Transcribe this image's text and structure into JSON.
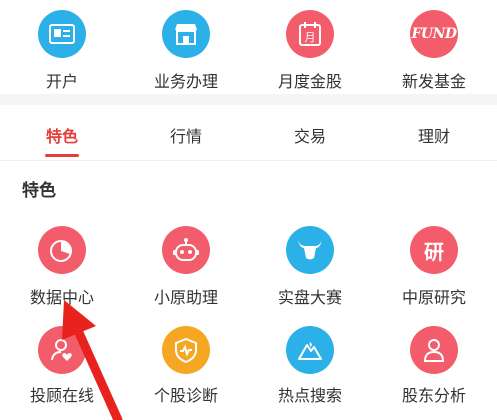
{
  "top_row": [
    {
      "label": "开户",
      "icon": "id-card-icon",
      "color": "#2bb0e8"
    },
    {
      "label": "业务办理",
      "icon": "storefront-icon",
      "color": "#2bb0e8"
    },
    {
      "label": "月度金股",
      "icon": "calendar-icon",
      "color": "#f25c6b"
    },
    {
      "label": "新发基金",
      "icon": "fund-logo-icon",
      "icon_text": "FUND",
      "color": "#f25c6b"
    }
  ],
  "tabs": [
    {
      "label": "特色",
      "active": true
    },
    {
      "label": "行情",
      "active": false
    },
    {
      "label": "交易",
      "active": false
    },
    {
      "label": "理财",
      "active": false
    }
  ],
  "section_title": "特色",
  "feature_row_1": [
    {
      "label": "数据中心",
      "icon": "pie-chart-icon",
      "color": "#f25c6b"
    },
    {
      "label": "小原助理",
      "icon": "robot-face-icon",
      "color": "#f25c6b"
    },
    {
      "label": "实盘大赛",
      "icon": "bull-icon",
      "color": "#2bb0e8"
    },
    {
      "label": "中原研究",
      "icon": "research-icon",
      "icon_text": "研",
      "color": "#f25c6b"
    }
  ],
  "feature_row_2": [
    {
      "label": "投顾在线",
      "icon": "advisor-heart-icon",
      "color": "#f25c6b"
    },
    {
      "label": "个股诊断",
      "icon": "shield-pulse-icon",
      "color": "#f5a623"
    },
    {
      "label": "热点搜索",
      "icon": "hot-mountain-icon",
      "color": "#2bb0e8"
    },
    {
      "label": "股东分析",
      "icon": "person-icon",
      "color": "#f25c6b"
    }
  ],
  "colors": {
    "accent": "#e63c3c",
    "blue": "#2bb0e8",
    "pink": "#f25c6b",
    "orange": "#f5a623"
  }
}
